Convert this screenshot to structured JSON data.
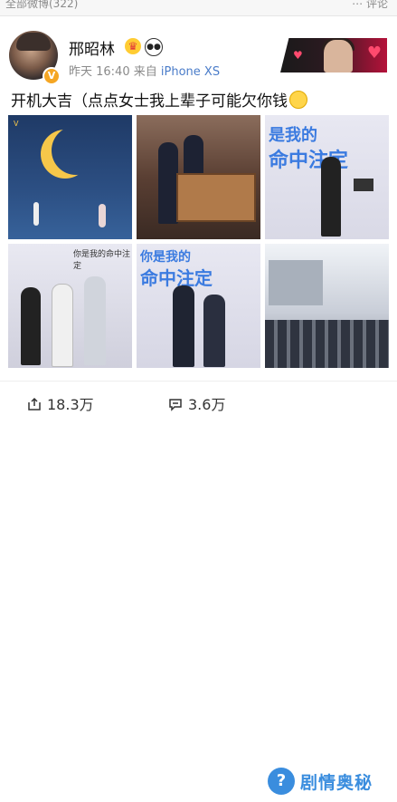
{
  "topbar": {
    "left_text": "全部微博(322)",
    "right_text": "⋯ 评论"
  },
  "post": {
    "author": "邢昭林",
    "time": "昨天 16:40",
    "source_prefix": "来自",
    "source": "iPhone XS",
    "text": "开机大吉（点点女士我上辈子可能欠你钱",
    "badges": [
      "crown-icon",
      "panda-icon"
    ]
  },
  "images": [
    {
      "id": "img-1",
      "label": "",
      "caption": ""
    },
    {
      "id": "img-2",
      "label": ""
    },
    {
      "id": "img-3",
      "label": "是我的",
      "label2": "命中注定"
    },
    {
      "id": "img-4",
      "label": "你是我的命中注定"
    },
    {
      "id": "img-5",
      "label": "你是我的",
      "label2": "命中注定"
    },
    {
      "id": "img-6",
      "label": ""
    }
  ],
  "actions": {
    "share_count": "18.3万",
    "comment_count": "3.6万"
  },
  "watermark": {
    "text": "剧情奥秘",
    "sub": ""
  },
  "colors": {
    "link": "#4a7cc9",
    "accent": "#e23a3a"
  }
}
